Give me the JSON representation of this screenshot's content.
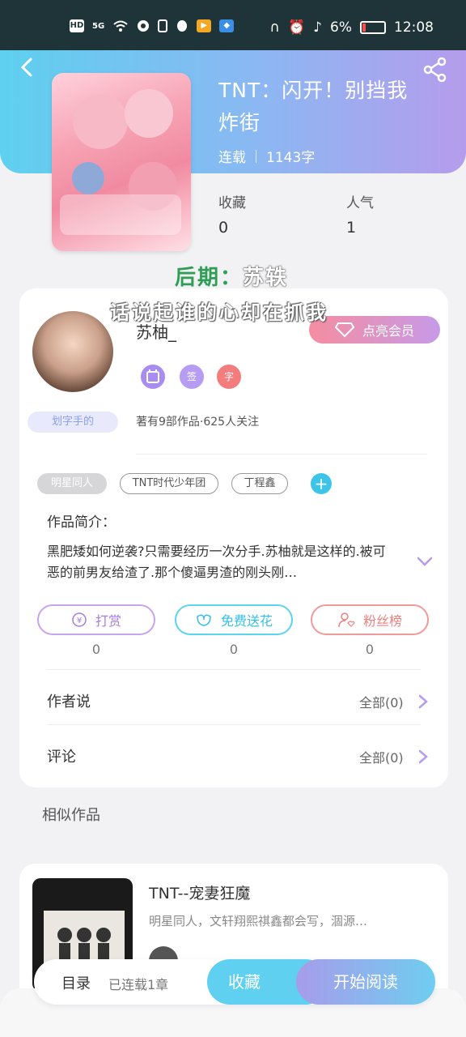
{
  "status_bar": {
    "left_icons": [
      "HD",
      "5G",
      "wifi-icon",
      "app-icon",
      "sim-icon",
      "qq-icon",
      "video-icon",
      "browser-icon"
    ],
    "battery_percent": "6%",
    "time": "12:08"
  },
  "book": {
    "title": "TNT：闪开！别挡我炸街",
    "serial_status": "连载",
    "word_count": "1143字",
    "favorites_label": "收藏",
    "favorites_value": "0",
    "popularity_label": "人气",
    "popularity_value": "1",
    "late_tag_prefix": "后期：",
    "late_tag_name": "苏轶"
  },
  "overlay_text": "话说起谁的心却在抓我",
  "author": {
    "name": "苏柚_",
    "vip_button": "点亮会员",
    "badges": [
      "",
      "签",
      "字"
    ],
    "level_tag": "划字手的",
    "works_info": "著有9部作品·625人关注"
  },
  "tags": [
    "明星同人",
    "TNT时代少年团",
    "丁程鑫"
  ],
  "synopsis": {
    "label": "作品简介：",
    "text": "黑肥矮如何逆袭?只需要经历一次分手.苏柚就是这样的.被可恶的前男友给渣了.那个傻逼男渣的刚头刚…"
  },
  "actions": [
    {
      "label": "打赏",
      "count": "0"
    },
    {
      "label": "免费送花",
      "count": "0"
    },
    {
      "label": "粉丝榜",
      "count": "0"
    }
  ],
  "rows": {
    "author_says": "作者说",
    "author_says_all": "全部(0)",
    "comments": "评论",
    "comments_all": "全部(0)"
  },
  "similar": {
    "section_title": "相似作品",
    "title": "TNT--宠妻狂魔",
    "desc": "明星同人，文轩翔熙祺鑫都会写，涸源…"
  },
  "bottom": {
    "toc_label": "目录",
    "toc_status": "已连载1章",
    "collect": "收藏",
    "read": "开始阅读"
  },
  "colors": {
    "accent_cyan": "#5fd0ef",
    "accent_purple": "#b59cec",
    "vip_pink": "#f58da0"
  }
}
